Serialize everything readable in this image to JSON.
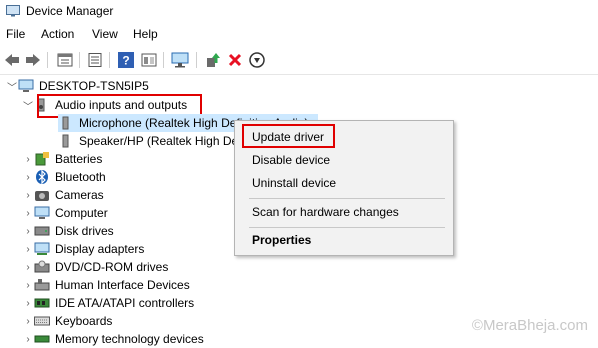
{
  "window": {
    "title": "Device Manager",
    "icon": "device-manager-icon"
  },
  "menu": [
    "File",
    "Action",
    "View",
    "Help"
  ],
  "toolbar": {
    "buttons": [
      "back-arrow-icon",
      "forward-arrow-icon",
      "properties-sheet-icon",
      "list-icon",
      "help-icon",
      "view-icon",
      "monitor-icon",
      "update-driver-icon",
      "uninstall-x-icon",
      "scan-down-icon"
    ],
    "uninstall_color": "#e81123"
  },
  "tree": {
    "root": "DESKTOP-TSN5IP5",
    "audio_category": "Audio inputs and outputs",
    "audio_children": [
      "Microphone (Realtek High Definition Audio)",
      "Speaker/HP (Realtek High Definition Audio)"
    ],
    "categories": [
      "Batteries",
      "Bluetooth",
      "Cameras",
      "Computer",
      "Disk drives",
      "Display adapters",
      "DVD/CD-ROM drives",
      "Human Interface Devices",
      "IDE ATA/ATAPI controllers",
      "Keyboards",
      "Memory technology devices"
    ]
  },
  "context_menu": {
    "update_driver": "Update driver",
    "disable_device": "Disable device",
    "uninstall_device": "Uninstall device",
    "scan": "Scan for hardware changes",
    "properties": "Properties"
  },
  "highlight_color": "#e00000",
  "selection_color": "#cce8ff",
  "watermark": "©MeraBheja.com"
}
